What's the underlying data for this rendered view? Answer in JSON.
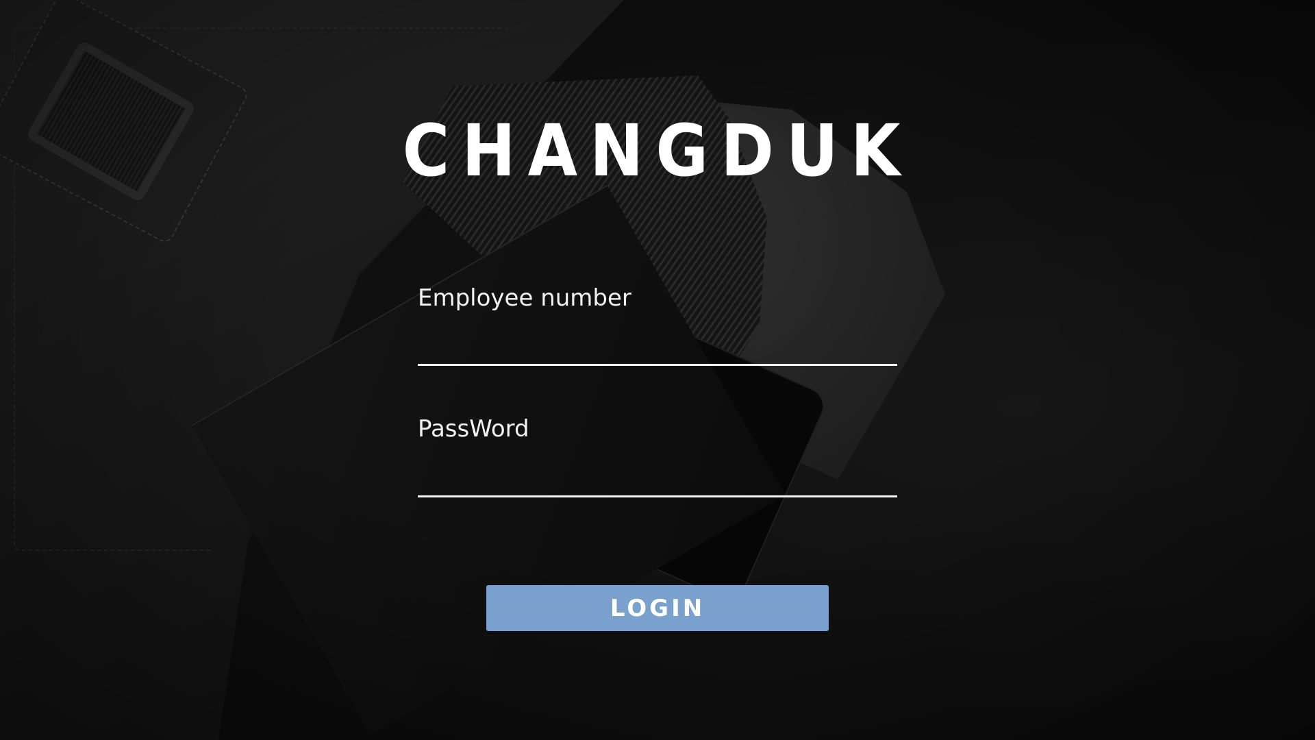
{
  "app": {
    "title": "CHANGDUK"
  },
  "login_form": {
    "employee_number": {
      "label": "Employee number",
      "value": "",
      "placeholder": ""
    },
    "password": {
      "label": "PassWord",
      "value": "",
      "placeholder": ""
    },
    "login_button_label": "LOGIN"
  },
  "colors": {
    "background": "#0d0d0d",
    "text": "#ffffff",
    "button": "#7aa1ce",
    "underline": "#f5f5f5"
  },
  "background_image": {
    "subject": "dark briefcase with striped tie and smartphone"
  }
}
